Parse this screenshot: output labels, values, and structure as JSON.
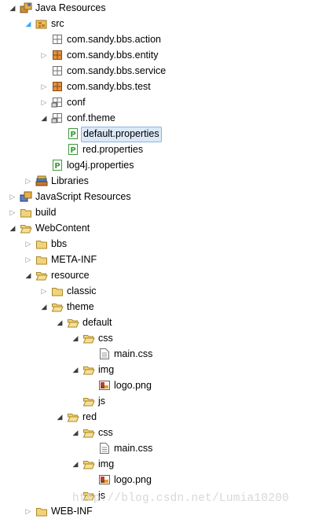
{
  "tree": {
    "rows": [
      {
        "label": "Java Resources",
        "depth": 0,
        "state": "expanded",
        "icon": "java-resources-icon"
      },
      {
        "label": "src",
        "depth": 1,
        "state": "source",
        "icon": "source-folder-icon"
      },
      {
        "label": "com.sandy.bbs.action",
        "depth": 2,
        "state": "leaf",
        "icon": "empty-package-icon"
      },
      {
        "label": "com.sandy.bbs.entity",
        "depth": 2,
        "state": "collapsed",
        "icon": "package-icon"
      },
      {
        "label": "com.sandy.bbs.service",
        "depth": 2,
        "state": "leaf",
        "icon": "empty-package-icon"
      },
      {
        "label": "com.sandy.bbs.test",
        "depth": 2,
        "state": "collapsed",
        "icon": "package-icon"
      },
      {
        "label": "conf",
        "depth": 2,
        "state": "collapsed",
        "icon": "resource-package-icon"
      },
      {
        "label": "conf.theme",
        "depth": 2,
        "state": "expanded",
        "icon": "resource-package-icon"
      },
      {
        "label": "default.properties",
        "depth": 3,
        "state": "leaf",
        "icon": "properties-file-icon",
        "selected": true
      },
      {
        "label": "red.properties",
        "depth": 3,
        "state": "leaf",
        "icon": "properties-file-icon"
      },
      {
        "label": "log4j.properties",
        "depth": 2,
        "state": "leaf",
        "icon": "properties-file-icon"
      },
      {
        "label": "Libraries",
        "depth": 1,
        "state": "collapsed",
        "icon": "libraries-icon"
      },
      {
        "label": "JavaScript Resources",
        "depth": 0,
        "state": "collapsed",
        "icon": "javascript-resources-icon"
      },
      {
        "label": "build",
        "depth": 0,
        "state": "collapsed",
        "icon": "folder-icon"
      },
      {
        "label": "WebContent",
        "depth": 0,
        "state": "expanded",
        "icon": "open-folder-icon"
      },
      {
        "label": "bbs",
        "depth": 1,
        "state": "collapsed",
        "icon": "folder-icon"
      },
      {
        "label": "META-INF",
        "depth": 1,
        "state": "collapsed",
        "icon": "folder-icon"
      },
      {
        "label": "resource",
        "depth": 1,
        "state": "expanded",
        "icon": "open-folder-icon"
      },
      {
        "label": "classic",
        "depth": 2,
        "state": "collapsed",
        "icon": "folder-icon"
      },
      {
        "label": "theme",
        "depth": 2,
        "state": "expanded",
        "icon": "open-folder-icon"
      },
      {
        "label": "default",
        "depth": 3,
        "state": "expanded",
        "icon": "open-folder-icon"
      },
      {
        "label": "css",
        "depth": 4,
        "state": "expanded",
        "icon": "open-folder-icon"
      },
      {
        "label": "main.css",
        "depth": 5,
        "state": "leaf",
        "icon": "css-file-icon"
      },
      {
        "label": "img",
        "depth": 4,
        "state": "expanded",
        "icon": "open-folder-icon"
      },
      {
        "label": "logo.png",
        "depth": 5,
        "state": "leaf",
        "icon": "image-file-icon"
      },
      {
        "label": "js",
        "depth": 4,
        "state": "leaf",
        "icon": "open-folder-icon"
      },
      {
        "label": "red",
        "depth": 3,
        "state": "expanded",
        "icon": "open-folder-icon"
      },
      {
        "label": "css",
        "depth": 4,
        "state": "expanded",
        "icon": "open-folder-icon"
      },
      {
        "label": "main.css",
        "depth": 5,
        "state": "leaf",
        "icon": "css-file-icon"
      },
      {
        "label": "img",
        "depth": 4,
        "state": "expanded",
        "icon": "open-folder-icon"
      },
      {
        "label": "logo.png",
        "depth": 5,
        "state": "leaf",
        "icon": "image-file-icon"
      },
      {
        "label": "js",
        "depth": 4,
        "state": "leaf",
        "icon": "open-folder-icon"
      },
      {
        "label": "WEB-INF",
        "depth": 1,
        "state": "collapsed",
        "icon": "folder-icon"
      }
    ]
  },
  "watermark": "http://blog.csdn.net/Lumia10200",
  "colors": {
    "selection_bg": "#dbe8f7",
    "selection_border": "#8fb4e0",
    "folder": "#e8c25a",
    "package": "#c8782c",
    "properties_green": "#3c9a3c"
  }
}
